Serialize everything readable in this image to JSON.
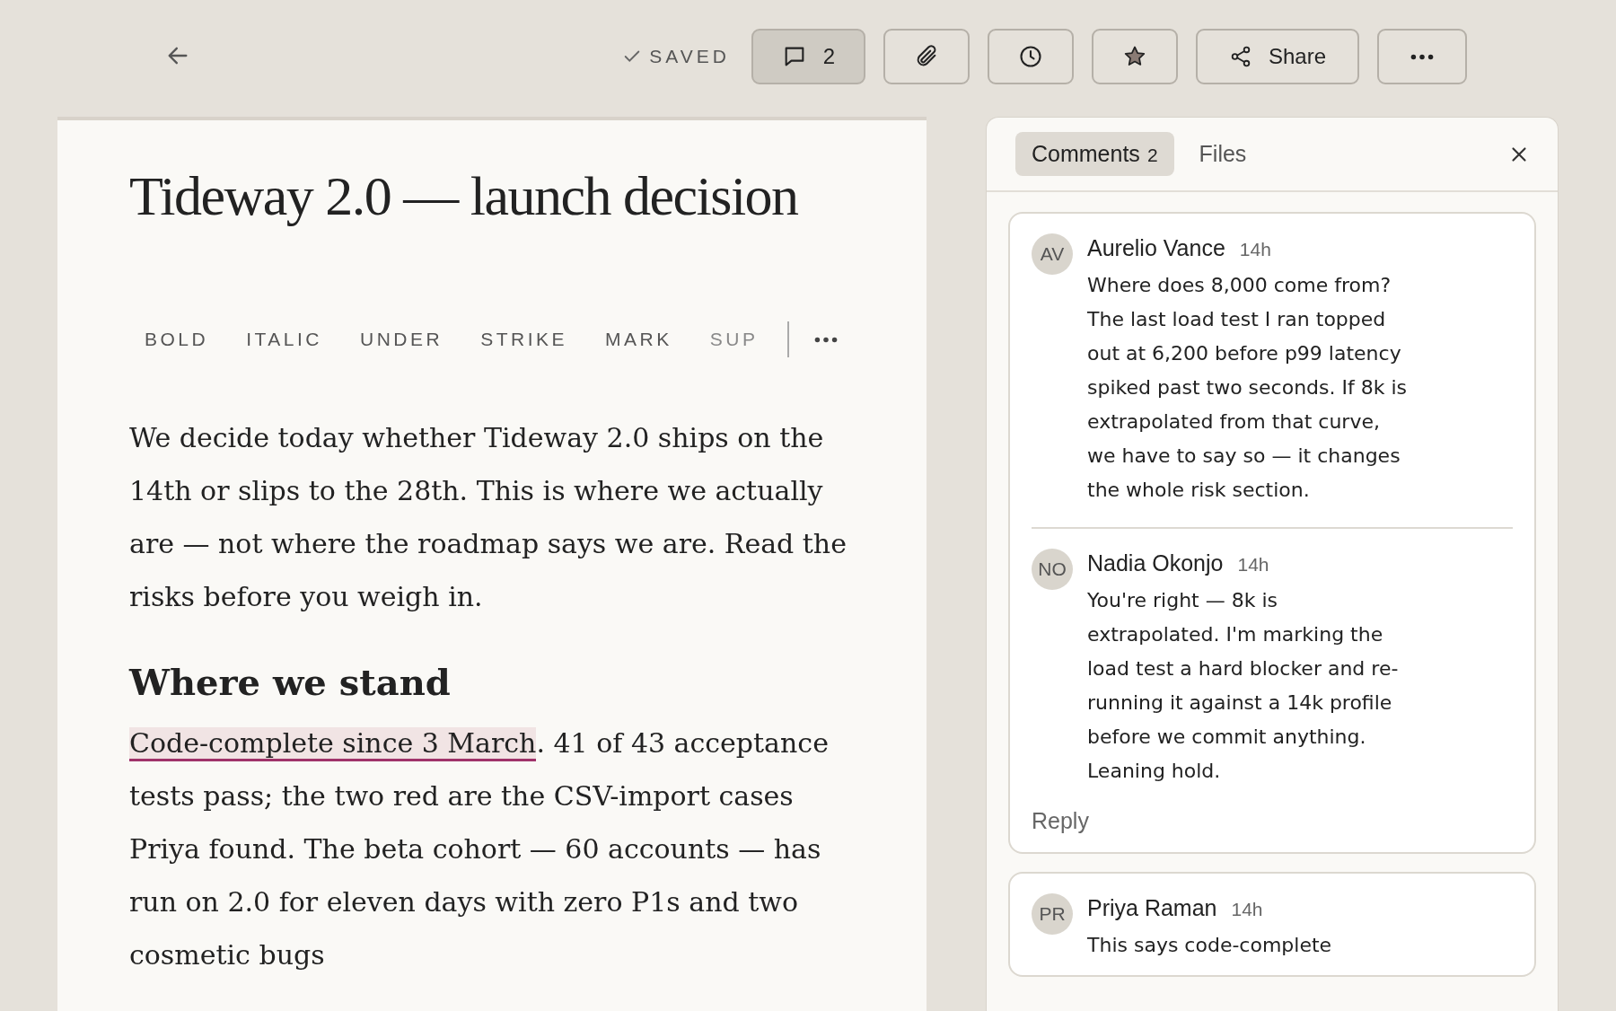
{
  "toolbar": {
    "save_status": "SAVED",
    "buttons": [
      {
        "kind": "comments",
        "label": "2",
        "selected": true
      },
      {
        "kind": "attach",
        "selected": false
      },
      {
        "kind": "history",
        "selected": false
      },
      {
        "kind": "star",
        "selected": false
      },
      {
        "kind": "share",
        "label": "Share",
        "selected": false
      },
      {
        "kind": "more",
        "selected": false
      }
    ]
  },
  "document": {
    "title": "Tideway 2.0 — launch decision",
    "format_bar": [
      "BOLD",
      "ITALIC",
      "UNDER",
      "STRIKE",
      "MARK",
      "SUP"
    ],
    "blocks": [
      {
        "kind": "paragraph",
        "parts": [
          {
            "text": "We decide today whether Tideway 2.0 ships on the 14th or slips to the 28th. This is where we actually are — not where the roadmap says we are. Read the risks before you weigh in."
          }
        ]
      },
      {
        "kind": "heading",
        "parts": [
          {
            "text": "Where we stand"
          }
        ]
      },
      {
        "kind": "paragraph",
        "parts": [
          {
            "text": "Code-complete since 3 March",
            "highlighted": true
          },
          {
            "text": ". 41 of 43 acceptance tests pass; the two red are the CSV-import cases Priya found. The beta cohort — 60 accounts — has run on 2.0 for eleven days with zero P1s and two cosmetic bugs"
          }
        ]
      }
    ]
  },
  "sidebar": {
    "tabs": [
      {
        "label": "Comments",
        "count": "2",
        "selected": true
      },
      {
        "label": "Files",
        "selected": false
      }
    ],
    "threads": [
      {
        "comments": [
          {
            "initials": "AV",
            "author": "Aurelio Vance",
            "time": "14h",
            "text": "Where does 8,000 come from? The last load test I ran topped out at 6,200 before p99 latency spiked past two seconds. If 8k is extrapolated from that curve, we have to say so — it changes the whole risk section."
          },
          {
            "initials": "NO",
            "author": "Nadia Okonjo",
            "time": "14h",
            "text": "You're right — 8k is extrapolated. I'm marking the load test a hard blocker and re-running it against a 14k profile before we commit anything. Leaning hold."
          }
        ],
        "reply": "Reply"
      },
      {
        "comments": [
          {
            "initials": "PR",
            "author": "Priya Raman",
            "time": "14h",
            "text": "This says code-complete"
          }
        ]
      }
    ]
  }
}
